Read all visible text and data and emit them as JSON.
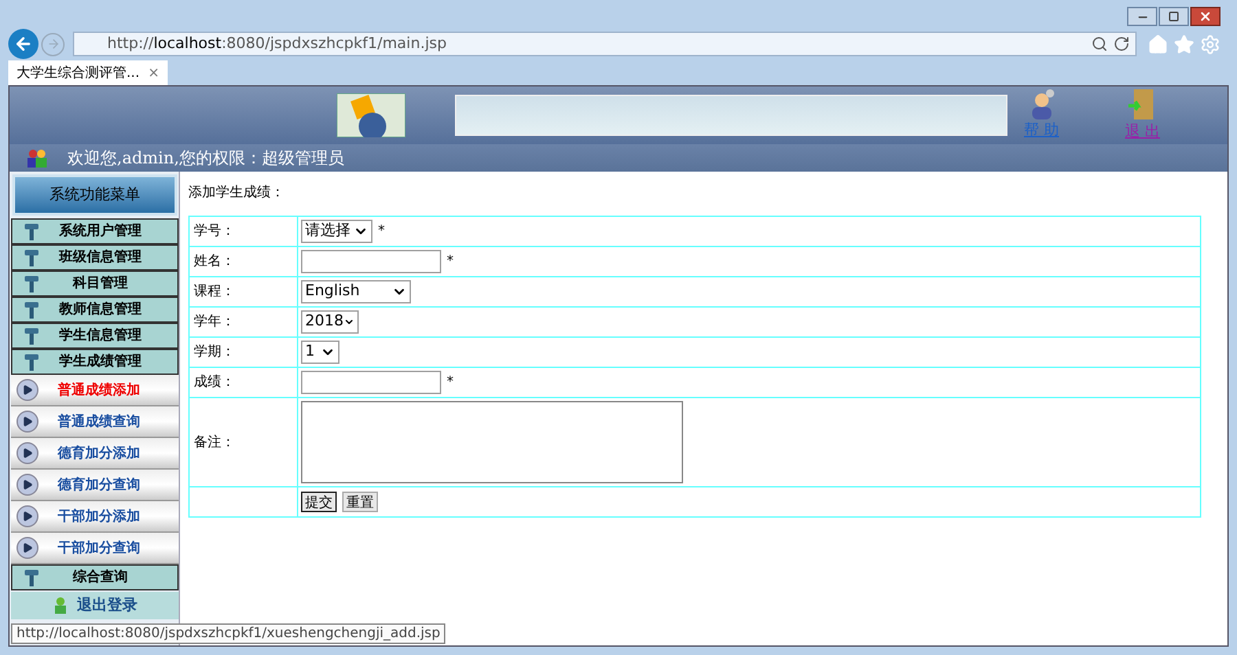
{
  "browser": {
    "url_prefix": "http://",
    "url_host": "localhost",
    "url_rest": ":8080/jspdxszhcpkf1/main.jsp",
    "tab_title": "大学生综合测评管...",
    "tab_close": "×",
    "status_url": "http://localhost:8080/jspdxszhcpkf1/xueshengchengji_add.jsp"
  },
  "header": {
    "help_link": "帮 助",
    "logout_link": "退 出"
  },
  "welcome": "欢迎您,admin,您的权限：超级管理员",
  "sidebar": {
    "title": "系统功能菜单",
    "items": [
      {
        "kind": "section",
        "label": "系统用户管理",
        "selected": false
      },
      {
        "kind": "section",
        "label": "班级信息管理",
        "selected": false
      },
      {
        "kind": "section",
        "label": "科目管理",
        "selected": false
      },
      {
        "kind": "section",
        "label": "教师信息管理",
        "selected": false
      },
      {
        "kind": "section",
        "label": "学生信息管理",
        "selected": false
      },
      {
        "kind": "section",
        "label": "学生成绩管理",
        "selected": false
      },
      {
        "kind": "link",
        "label": "普通成绩添加",
        "selected": true
      },
      {
        "kind": "link",
        "label": "普通成绩查询",
        "selected": false
      },
      {
        "kind": "link",
        "label": "德育加分添加",
        "selected": false
      },
      {
        "kind": "link",
        "label": "德育加分查询",
        "selected": false
      },
      {
        "kind": "link",
        "label": "干部加分添加",
        "selected": false
      },
      {
        "kind": "link",
        "label": "干部加分查询",
        "selected": false
      },
      {
        "kind": "section",
        "label": "综合查询",
        "selected": false
      },
      {
        "kind": "logout",
        "label": "退出登录",
        "selected": false
      }
    ]
  },
  "form": {
    "title": "添加学生成绩：",
    "fields": [
      {
        "kind": "select",
        "label": "学号：",
        "value": "请选择",
        "required": "*"
      },
      {
        "kind": "text",
        "label": "姓名：",
        "required": "*"
      },
      {
        "kind": "select",
        "label": "课程：",
        "value": "English"
      },
      {
        "kind": "select",
        "label": "学年：",
        "value": "2018"
      },
      {
        "kind": "select",
        "label": "学期：",
        "value": "1"
      },
      {
        "kind": "text",
        "label": "成绩：",
        "required": "*"
      },
      {
        "kind": "textarea",
        "label": "备注："
      }
    ],
    "buttons": [
      "提交",
      "重置"
    ]
  }
}
